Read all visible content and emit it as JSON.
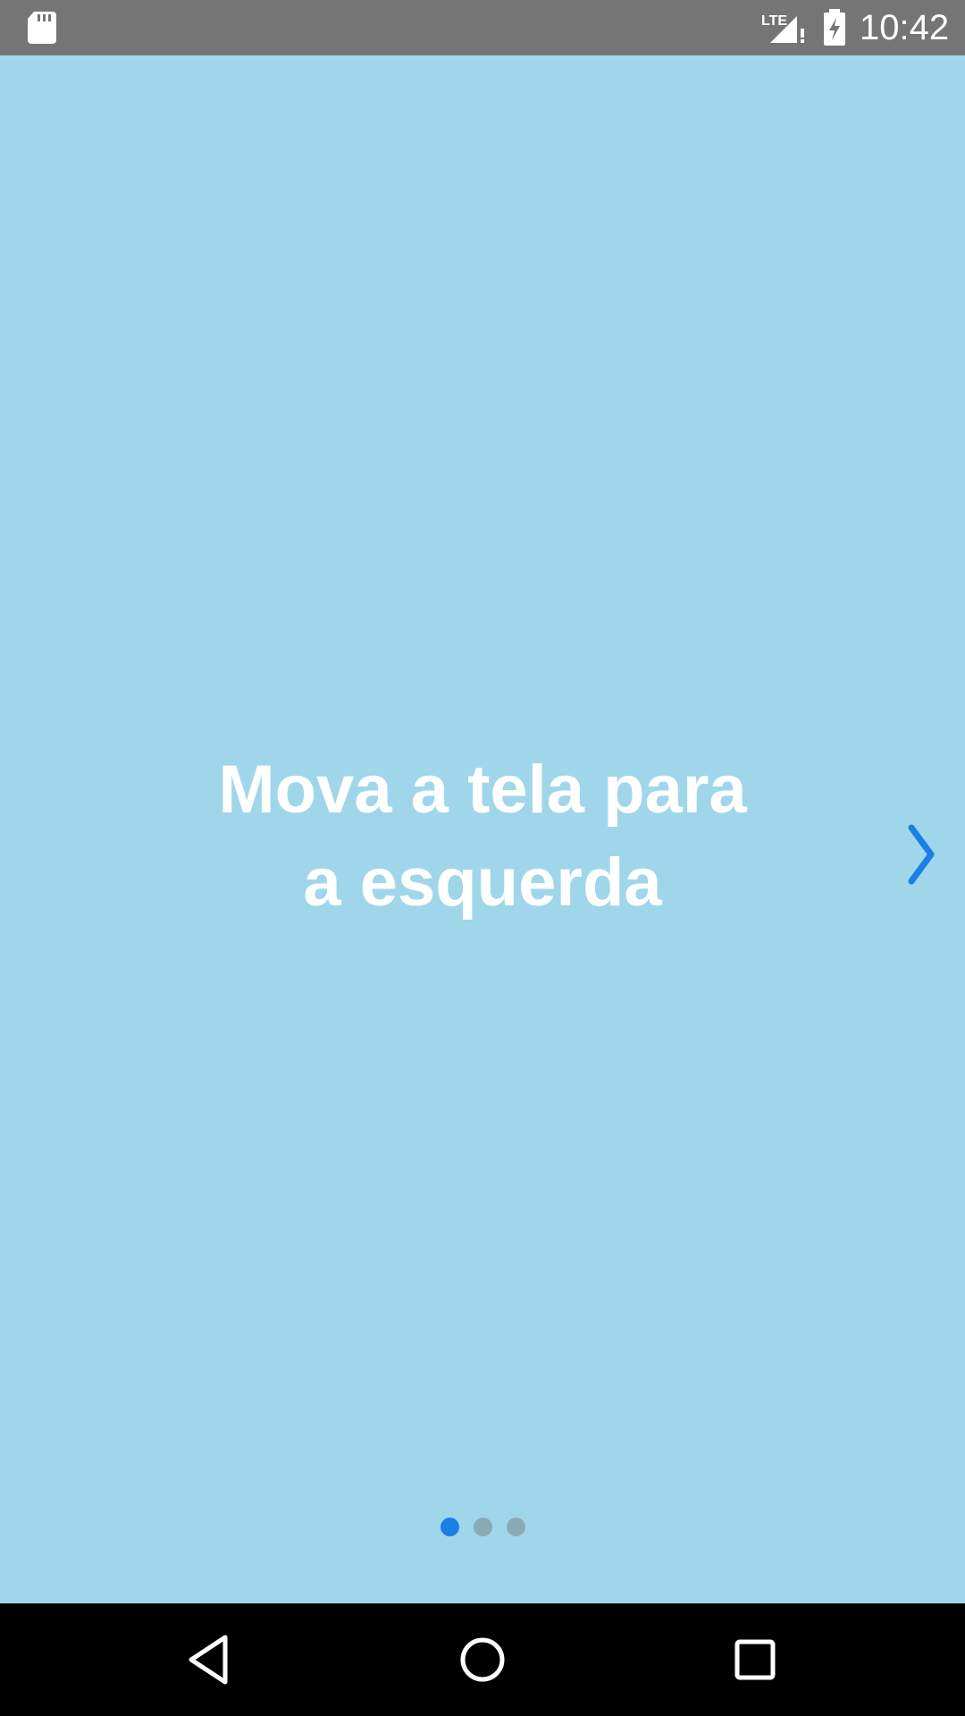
{
  "status_bar": {
    "time": "10:42",
    "network_label": "LTE",
    "icons": [
      "sd-card-icon",
      "signal-icon",
      "battery-charging-icon"
    ]
  },
  "onboarding": {
    "headline_line1": "Mova a tela para",
    "headline_line2": "a esquerda",
    "next_icon": "chevron-right-icon",
    "page_indicator": {
      "total_pages": 3,
      "current_page": 1
    }
  },
  "navigation_bar": {
    "buttons": [
      "back-icon",
      "home-icon",
      "recents-icon"
    ]
  },
  "colors": {
    "background": "#a0d6ea",
    "status_bar": "#757575",
    "accent": "#1a7fe6",
    "inactive_dot": "#8aaab5",
    "headline_text": "#ffffff",
    "nav_bar": "#000000"
  }
}
